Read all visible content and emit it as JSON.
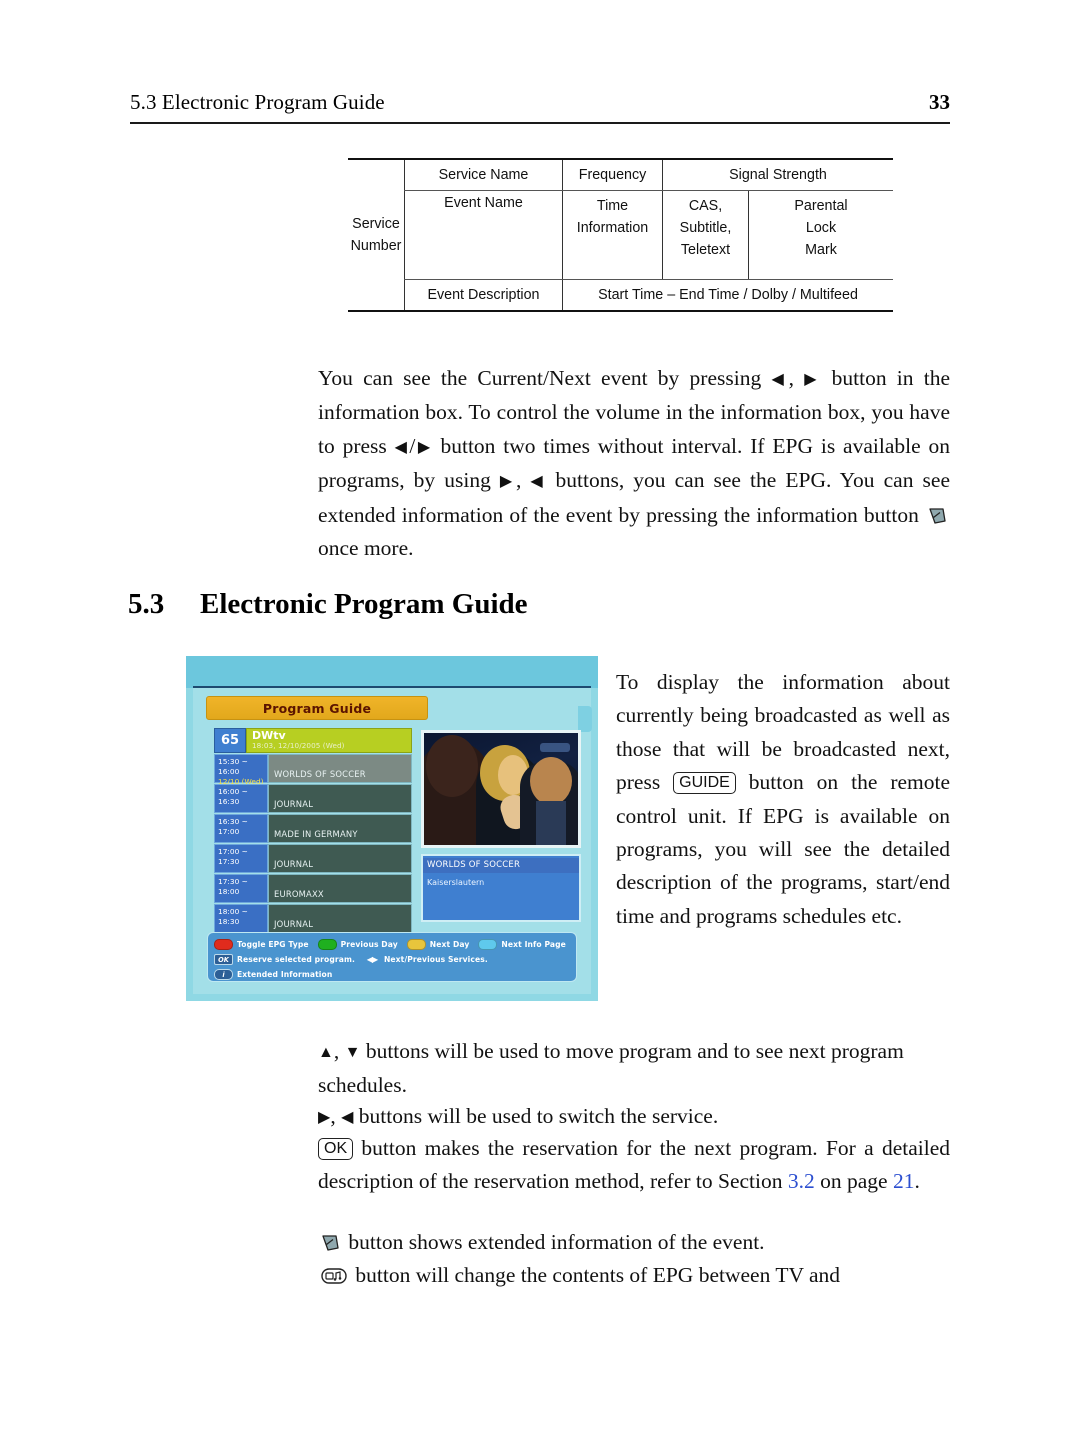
{
  "header": {
    "title": "5.3 Electronic Program Guide",
    "page_number": "33"
  },
  "schematic_table": {
    "row1": {
      "service_name": "Service Name",
      "frequency": "Frequency",
      "signal_strength": "Signal Strength"
    },
    "row2": {
      "service_number_line1": "Service",
      "service_number_line2": "Number",
      "event_name": "Event Name",
      "time_line1": "Time",
      "time_line2": "Information",
      "cas_line1": "CAS,",
      "cas_line2": "Subtitle,",
      "cas_line3": "Teletext",
      "parental_line1": "Parental",
      "parental_line2": "Lock",
      "parental_line3": "Mark"
    },
    "row3": {
      "event_description": "Event Description",
      "time_detail": "Start Time – End Time / Dolby / Multifeed"
    }
  },
  "paragraphs": {
    "info_box": {
      "t1": "You can see the Current/Next event by pressing ",
      "t2": ", ",
      "t3": " button in the information box. To control the volume in the information box, you have to press ",
      "t4": "/",
      "t5": " button two times without interval. If EPG is available on programs, by using ",
      "t6": ", ",
      "t7": " buttons, you can see the EPG. You can see extended information of the event by pressing the information button ",
      "t8": " once more."
    },
    "guide": {
      "t1": "To display the information about currently being broadcasted as well as those that will be broadcasted next, press ",
      "key": "GUIDE",
      "t2": " button on the remote control unit. If EPG is available on programs, you will see the detailed description of the programs, start/end time and programs schedules etc."
    },
    "arrows": {
      "t1": ", ",
      "t2": " buttons will be used to move program and to see next program schedules."
    },
    "leftright": {
      "t1": ", ",
      "t2": " buttons will be used to switch the service."
    },
    "ok": {
      "key": "OK",
      "t1": " button makes the reservation for the next program. For a detailed description of the reservation method, refer to Section ",
      "link_section": "3.2",
      "t2": " on page ",
      "link_page": "21",
      "t3": "."
    },
    "extended_info": {
      "t1": " button shows extended information of the event."
    },
    "tv_radio": {
      "t1": " button will change the contents of EPG between TV and"
    }
  },
  "section": {
    "number": "5.3",
    "title": "Electronic Program Guide"
  },
  "epg_screenshot": {
    "title": "Program Guide",
    "channel": {
      "number": "65",
      "name": "DWtv",
      "datetime": "18:03, 12/10/2005 (Wed)"
    },
    "schedule": [
      {
        "slot": "15:30 ~ 16:00",
        "slot_date": "12/10 (Wed)",
        "program": "WORLDS OF SOCCER",
        "current": true
      },
      {
        "slot": "16:00 ~ 16:30",
        "slot_date": "",
        "program": "JOURNAL",
        "current": false
      },
      {
        "slot": "16:30 ~ 17:00",
        "slot_date": "",
        "program": "MADE IN GERMANY",
        "current": false
      },
      {
        "slot": "17:00 ~ 17:30",
        "slot_date": "",
        "program": "JOURNAL",
        "current": false
      },
      {
        "slot": "17:30 ~ 18:00",
        "slot_date": "",
        "program": "EUROMAXX",
        "current": false
      },
      {
        "slot": "18:00 ~ 18:30",
        "slot_date": "",
        "program": "JOURNAL",
        "current": false
      }
    ],
    "detail": {
      "title": "WORLDS OF SOCCER",
      "body": "Kaiserslautern"
    },
    "help": {
      "red": "Toggle EPG Type",
      "green": "Previous Day",
      "yellow": "Next Day",
      "blue": "Next Info Page",
      "ok_key": "OK",
      "ok_text": "Reserve selected program.",
      "lr_key": "◀▶",
      "lr_text": "Next/Previous Services.",
      "i_key": "i",
      "i_text": "Extended Information"
    },
    "colors": {
      "title_bar": "#e2a81c",
      "channel_row": "#b7cf22",
      "slot": "#3a6fc4",
      "program": "#3f5a52",
      "help_bar": "#4a94cf",
      "background": "#a3dfe8"
    }
  },
  "glyphs": {
    "left": "◀",
    "right": "▶",
    "up": "▲",
    "down": "▼"
  }
}
